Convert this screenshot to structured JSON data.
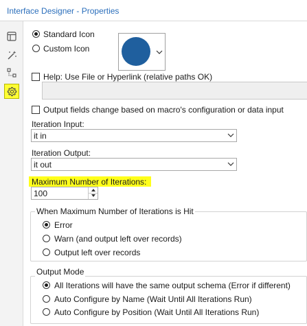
{
  "window": {
    "title": "Interface Designer - Properties"
  },
  "sidebar": {
    "items": [
      {
        "icon": "layout-icon",
        "active": false
      },
      {
        "icon": "magic-wand-icon",
        "active": false
      },
      {
        "icon": "tree-icon",
        "active": false
      },
      {
        "icon": "gear-icon",
        "active": true
      }
    ]
  },
  "icon_choice": {
    "standard_label": "Standard Icon",
    "custom_label": "Custom Icon",
    "selected": "standard",
    "icon_color": "#1f5f9e"
  },
  "help": {
    "label": "Help: Use File or Hyperlink (relative paths OK)",
    "checked": false,
    "value": ""
  },
  "output_fields": {
    "label": "Output fields change based on macro's configuration or data input",
    "checked": false
  },
  "iteration_input": {
    "label": "Iteration Input:",
    "value": "it in"
  },
  "iteration_output": {
    "label": "Iteration Output:",
    "value": "it out"
  },
  "max_iterations": {
    "label": "Maximum Number of Iterations:",
    "value": "100",
    "highlight_color": "#ffff1a"
  },
  "when_max_hit": {
    "title": "When Maximum Number of Iterations is Hit",
    "options": [
      "Error",
      "Warn (and output left over records)",
      "Output left over records"
    ],
    "selected_index": 0
  },
  "output_mode": {
    "title": "Output Mode",
    "options": [
      "All Iterations will have the same output schema (Error if different)",
      "Auto Configure by Name (Wait Until All Iterations Run)",
      "Auto Configure by Position (Wait Until All Iterations Run)"
    ],
    "selected_index": 0
  },
  "colors": {
    "title_text": "#2a6ebb",
    "active_icon_bg": "#ffff33",
    "sidebar_bg": "#f3f3f3"
  }
}
